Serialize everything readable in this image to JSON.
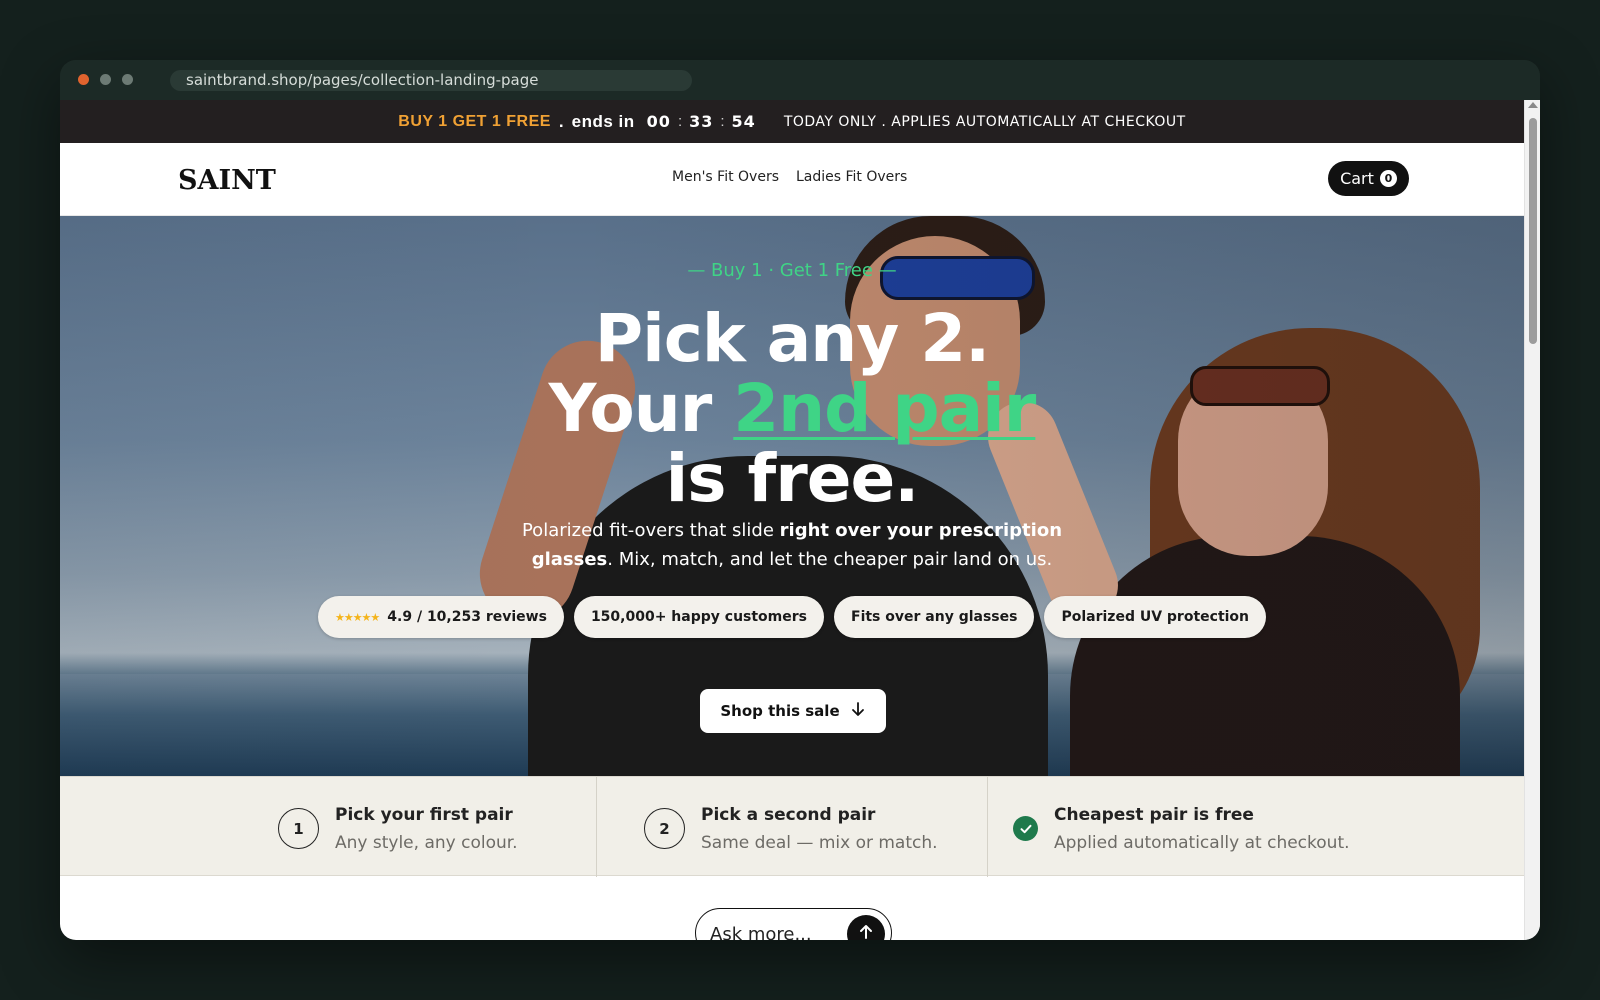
{
  "browser": {
    "url": "saintbrand.shop/pages/collection-landing-page"
  },
  "promo_bar": {
    "deal": "BUY 1 GET 1 FREE",
    "separator": ".",
    "ends_label": "ends in",
    "countdown": {
      "hours": "00",
      "minutes": "33",
      "seconds": "54"
    },
    "note": "TODAY ONLY . APPLIES AUTOMATICALLY AT CHECKOUT"
  },
  "header": {
    "logo": "SAINT",
    "nav": [
      {
        "label": "Men's Fit Overs"
      },
      {
        "label": "Ladies Fit Overs"
      }
    ],
    "cart_label": "Cart",
    "cart_count": "0"
  },
  "hero": {
    "eyebrow": "— Buy 1 · Get 1 Free —",
    "headline_line1": "Pick any 2.",
    "headline_line2_prefix": "Your ",
    "headline_line2_accent": "2nd pair",
    "headline_line3": "is free.",
    "subtext_part1": "Polarized fit-overs that slide ",
    "subtext_bold": "right over your prescription glasses",
    "subtext_part2": ". Mix, match, and let the cheaper pair land on us.",
    "pills": [
      {
        "label": "4.9 / 10,253 reviews",
        "stars": "★★★★★"
      },
      {
        "label": "150,000+ happy customers"
      },
      {
        "label": "Fits over any glasses"
      },
      {
        "label": "Polarized UV protection"
      }
    ],
    "cta_label": "Shop this sale"
  },
  "steps": [
    {
      "number": "1",
      "title": "Pick your first pair",
      "desc": "Any style, any colour."
    },
    {
      "number": "2",
      "title": "Pick a second pair",
      "desc": "Same deal — mix or match."
    },
    {
      "icon": "check-icon",
      "title": "Cheapest pair is free",
      "desc": "Applied automatically at checkout."
    }
  ],
  "ask": {
    "placeholder": "Ask more..."
  },
  "colors": {
    "accent_green": "#3fd486",
    "promo_orange": "#f0a134",
    "promo_bg": "#231f20",
    "check_green": "#1f7a4c"
  }
}
